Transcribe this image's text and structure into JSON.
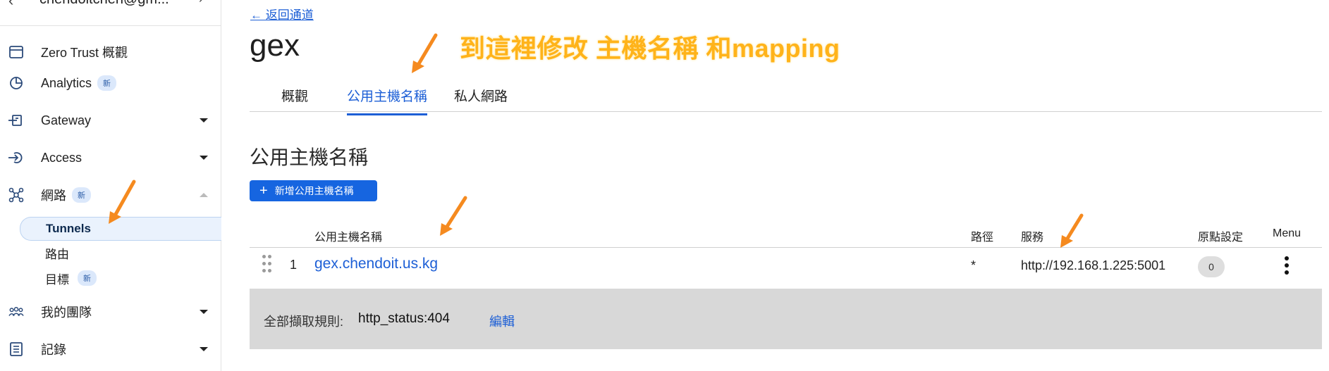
{
  "sidebar": {
    "account": {
      "back_glyph": "‹",
      "email": "chendoitchen@gm...",
      "chevron": "›"
    },
    "items": [
      {
        "label": "Zero Trust 概觀",
        "icon": "browser-window-icon",
        "badge": "",
        "caret": ""
      },
      {
        "label": "Analytics",
        "icon": "pie-chart-icon",
        "badge": "新",
        "caret": ""
      },
      {
        "label": "Gateway",
        "icon": "gateway-icon",
        "badge": "",
        "caret": "down"
      },
      {
        "label": "Access",
        "icon": "access-icon",
        "badge": "",
        "caret": "down"
      },
      {
        "label": "網路",
        "icon": "network-icon",
        "badge": "新",
        "caret": "up"
      },
      {
        "label": "我的團隊",
        "icon": "team-icon",
        "badge": "",
        "caret": "down"
      },
      {
        "label": "記錄",
        "icon": "logs-icon",
        "badge": "",
        "caret": "down"
      }
    ],
    "subitems": [
      {
        "label": "Tunnels",
        "active": true,
        "badge": ""
      },
      {
        "label": "路由",
        "active": false,
        "badge": ""
      },
      {
        "label": "目標",
        "active": false,
        "badge": "新"
      }
    ]
  },
  "main": {
    "back_link": "← 返回通道",
    "title": "gex",
    "annotation": "到這裡修改 主機名稱 和mapping",
    "tabs": [
      {
        "label": "概觀",
        "active": false
      },
      {
        "label": "公用主機名稱",
        "active": true
      },
      {
        "label": "私人網路",
        "active": false
      }
    ],
    "section_title": "公用主機名稱",
    "add_button": {
      "icon": "plus-icon",
      "label": "新增公用主機名稱"
    },
    "table": {
      "headers": {
        "hostname": "公用主機名稱",
        "path": "路徑",
        "service": "服務",
        "origin": "原點設定",
        "menu": "Menu"
      },
      "rows": [
        {
          "index": "1",
          "hostname": "gex.chendoit.us.kg",
          "path": "*",
          "service": "http://192.168.1.225:5001",
          "origin_count": "0"
        }
      ]
    },
    "catch_all": {
      "label": "全部擷取規則:",
      "value": "http_status:404",
      "edit": "編輯"
    }
  },
  "colors": {
    "accent": "#1d5fd6",
    "button": "#1665e0",
    "annotation": "#ffb31a",
    "arrow": "#f58a1f"
  }
}
